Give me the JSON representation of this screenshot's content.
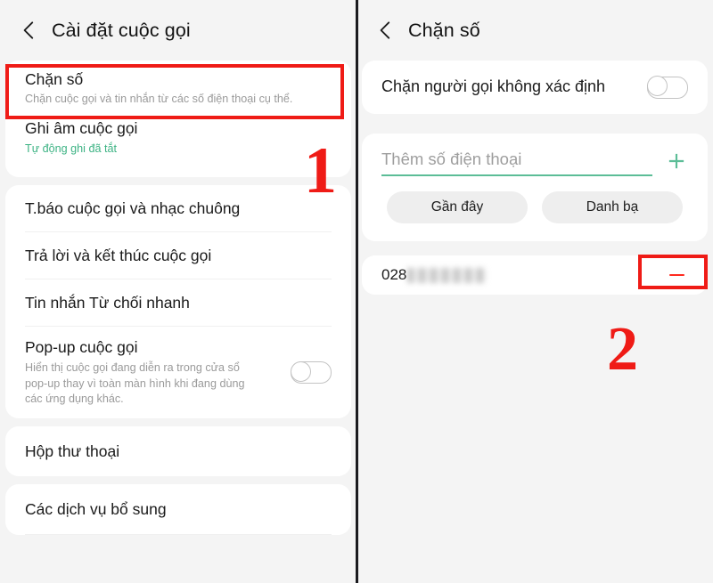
{
  "left_screen": {
    "appbar": {
      "back_icon": "back-chevron-icon",
      "title": "Cài đặt cuộc gọi"
    },
    "groups": [
      {
        "rows": [
          {
            "title": "Chặn số",
            "subtitle": "Chặn cuộc gọi và tin nhắn từ các số điện thoại cụ thể."
          },
          {
            "title": "Ghi âm cuộc gọi",
            "subtitle": "Tự động ghi đã tắt"
          }
        ]
      },
      {
        "rows": [
          {
            "title": "T.báo cuộc gọi và nhạc chuông"
          },
          {
            "title": "Trả lời và kết thúc cuộc gọi"
          },
          {
            "title": "Tin nhắn Từ chối nhanh"
          },
          {
            "title": "Pop-up cuộc gọi",
            "subtitle": "Hiển thị cuộc gọi đang diễn ra trong cửa sổ pop-up thay vì toàn màn hình khi đang dùng các ứng dụng khác.",
            "toggle": "off"
          }
        ]
      },
      {
        "rows": [
          {
            "title": "Hộp thư thoại"
          }
        ]
      },
      {
        "rows": [
          {
            "title": "Các dịch vụ bổ sung"
          }
        ]
      }
    ]
  },
  "right_screen": {
    "appbar": {
      "back_icon": "back-chevron-icon",
      "title": "Chặn số"
    },
    "unknown_caller": {
      "label": "Chặn người gọi không xác định",
      "toggle": "off"
    },
    "add_number": {
      "placeholder": "Thêm số điện thoại",
      "value": "",
      "add_icon": "plus-icon"
    },
    "chips": [
      {
        "label": "Gần đây"
      },
      {
        "label": "Danh bạ"
      }
    ],
    "blocked_list": [
      {
        "number_prefix": "028",
        "number_masked": true,
        "remove_icon": "minus-icon"
      }
    ]
  },
  "annotations": {
    "step_1": "1",
    "step_2": "2",
    "highlight_color": "#ef1b16"
  },
  "colors": {
    "accent_green": "#5cbd97",
    "subtitle_green": "#3db384",
    "annotation_red": "#ef1b16",
    "card_background": "#ffffff",
    "page_background": "#f4f4f4"
  }
}
